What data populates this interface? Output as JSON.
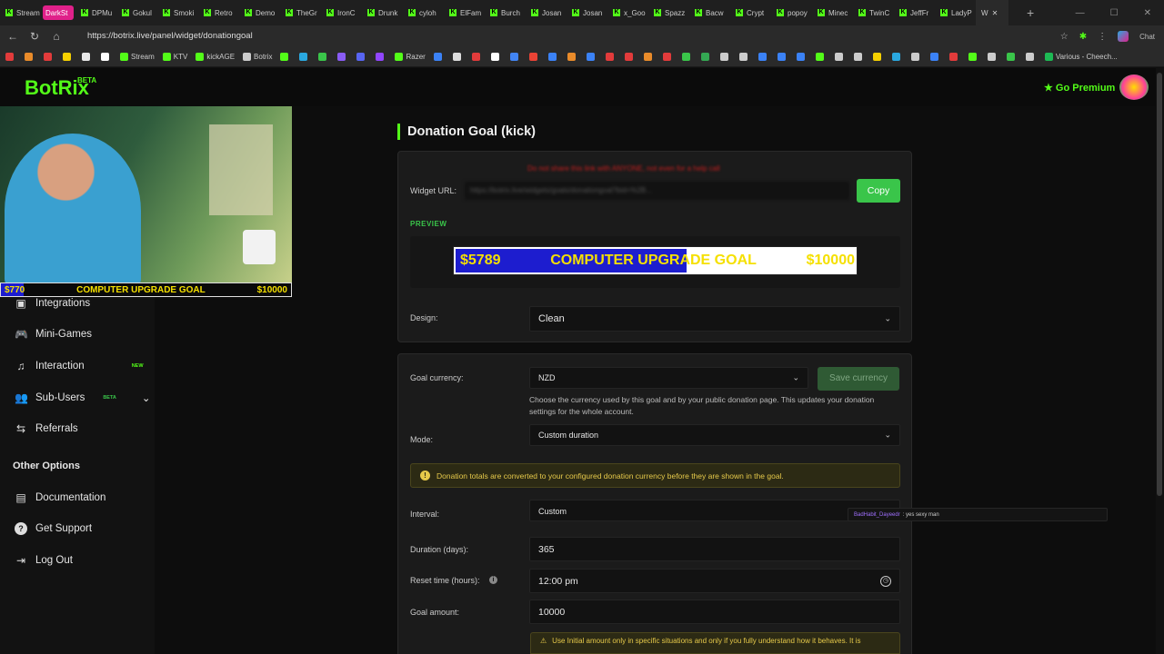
{
  "browser": {
    "tabs": [
      "Stream",
      "DarkSt",
      "DPMu",
      "Gokul",
      "Smoki",
      "Retro",
      "Demo",
      "TheGr",
      "IronC",
      "Drunk",
      "cyloh",
      "ElFam",
      "Burch",
      "Josan",
      "Josan",
      "x_Goo",
      "Spazz",
      "Bacw",
      "Crypt",
      "popoy",
      "Minec",
      "TwinC",
      "JeffFr",
      "LadyP"
    ],
    "active_tab": "W",
    "url": "https://botrix.live/panel/widget/donationgoal",
    "chat_label": "Chat",
    "bookmarks": [
      {
        "label": "",
        "color": "#e23b3b"
      },
      {
        "label": "",
        "color": "#e98b2a"
      },
      {
        "label": "",
        "color": "#e23b3b"
      },
      {
        "label": "",
        "color": "#f5d000"
      },
      {
        "label": "",
        "color": "#e8e8e8"
      },
      {
        "label": "",
        "color": "#ffffff"
      },
      {
        "label": "Stream",
        "color": "#53fc18"
      },
      {
        "label": "KTV",
        "color": "#53fc18"
      },
      {
        "label": "kickAGE",
        "color": "#53fc18"
      },
      {
        "label": "Botrix",
        "color": "#cccccc"
      },
      {
        "label": "",
        "color": "#53fc18"
      },
      {
        "label": "",
        "color": "#2aa8e0"
      },
      {
        "label": "",
        "color": "#3ac54a"
      },
      {
        "label": "",
        "color": "#8a5cf5"
      },
      {
        "label": "",
        "color": "#5865f2"
      },
      {
        "label": "",
        "color": "#9146ff"
      },
      {
        "label": "Razer",
        "color": "#53fc18"
      },
      {
        "label": "",
        "color": "#3b82f6"
      },
      {
        "label": "",
        "color": "#dddddd"
      },
      {
        "label": "",
        "color": "#e23b3b"
      },
      {
        "label": "",
        "color": "#ffffff"
      },
      {
        "label": "",
        "color": "#4285f4"
      },
      {
        "label": "",
        "color": "#ea4335"
      },
      {
        "label": "",
        "color": "#3b82f6"
      },
      {
        "label": "",
        "color": "#e98b2a"
      },
      {
        "label": "",
        "color": "#3b82f6"
      },
      {
        "label": "",
        "color": "#e23b3b"
      },
      {
        "label": "",
        "color": "#e23b3b"
      },
      {
        "label": "",
        "color": "#e98b2a"
      },
      {
        "label": "",
        "color": "#e23b3b"
      },
      {
        "label": "",
        "color": "#3ac54a"
      },
      {
        "label": "",
        "color": "#34a853"
      },
      {
        "label": "",
        "color": "#cccccc"
      },
      {
        "label": "",
        "color": "#cccccc"
      },
      {
        "label": "",
        "color": "#3b82f6"
      },
      {
        "label": "",
        "color": "#3b82f6"
      },
      {
        "label": "",
        "color": "#3b82f6"
      },
      {
        "label": "",
        "color": "#53fc18"
      },
      {
        "label": "",
        "color": "#cccccc"
      },
      {
        "label": "",
        "color": "#cccccc"
      },
      {
        "label": "",
        "color": "#f5d000"
      },
      {
        "label": "",
        "color": "#2aa8e0"
      },
      {
        "label": "",
        "color": "#cccccc"
      },
      {
        "label": "",
        "color": "#3b82f6"
      },
      {
        "label": "",
        "color": "#e23b3b"
      },
      {
        "label": "",
        "color": "#53fc18"
      },
      {
        "label": "",
        "color": "#cccccc"
      },
      {
        "label": "",
        "color": "#3ac54a"
      },
      {
        "label": "",
        "color": "#cccccc"
      },
      {
        "label": "Various - Cheech...",
        "color": "#1db954"
      }
    ]
  },
  "app": {
    "logo": "BotRix",
    "logo_badge": "BETA",
    "premium_label": "Go Premium",
    "accent": "#53fc18"
  },
  "sidebar": {
    "items": [
      {
        "label": "Integrations",
        "icon": "integrations-icon",
        "glyph": "▣"
      },
      {
        "label": "Mini-Games",
        "icon": "gamepad-icon",
        "glyph": "🎮"
      },
      {
        "label": "Interaction",
        "icon": "music-note-icon",
        "glyph": "♫",
        "badge": "NEW"
      },
      {
        "label": "Sub-Users",
        "icon": "users-icon",
        "glyph": "👥",
        "badge": "BETA"
      },
      {
        "label": "Referrals",
        "icon": "referrals-icon",
        "glyph": "⇆"
      }
    ],
    "other_heading": "Other Options",
    "other_items": [
      {
        "label": "Documentation",
        "icon": "documentation-icon",
        "glyph": "▤"
      },
      {
        "label": "Get Support",
        "icon": "help-icon",
        "glyph": "?"
      },
      {
        "label": "Log Out",
        "icon": "logout-icon",
        "glyph": "⇥"
      }
    ]
  },
  "stream_overlay": {
    "current": "$770",
    "title": "COMPUTER UPGRADE GOAL",
    "target": "$10000",
    "progress": 0.077
  },
  "main": {
    "title": "Donation Goal (kick)",
    "warning": "Do not share this link with ANYONE, not even for a help call",
    "widget_url_label": "Widget URL:",
    "widget_url": "https://botrix.live/widgets/goals/donationgoal?bid=%2B...",
    "copy_label": "Copy",
    "preview_label": "PREVIEW",
    "preview": {
      "current": "$5789",
      "title": "COMPUTER UPGRADE GOAL",
      "target": "$10000",
      "progress": 0.5789
    },
    "design_label": "Design:",
    "design_value": "Clean",
    "currency_label": "Goal currency:",
    "currency_value": "NZD",
    "save_currency_label": "Save currency",
    "currency_help": "Choose the currency used by this goal and by your public donation page. This updates your donation settings for the whole account.",
    "mode_label": "Mode:",
    "mode_value": "Custom duration",
    "info_text": "Donation totals are converted to your configured donation currency before they are shown in the goal.",
    "interval_label": "Interval:",
    "interval_value": "Custom",
    "duration_label": "Duration (days):",
    "duration_value": "365",
    "reset_label": "Reset time (hours):",
    "reset_value": "12:00 pm",
    "goal_amount_label": "Goal amount:",
    "goal_amount_value": "10000",
    "bottom_warning": "Use Initial amount only in specific situations and only if you fully understand how it behaves. It is"
  },
  "chat_popup": {
    "user": "BadHabit_Dayeedr",
    "message": ": yes sexy man"
  }
}
